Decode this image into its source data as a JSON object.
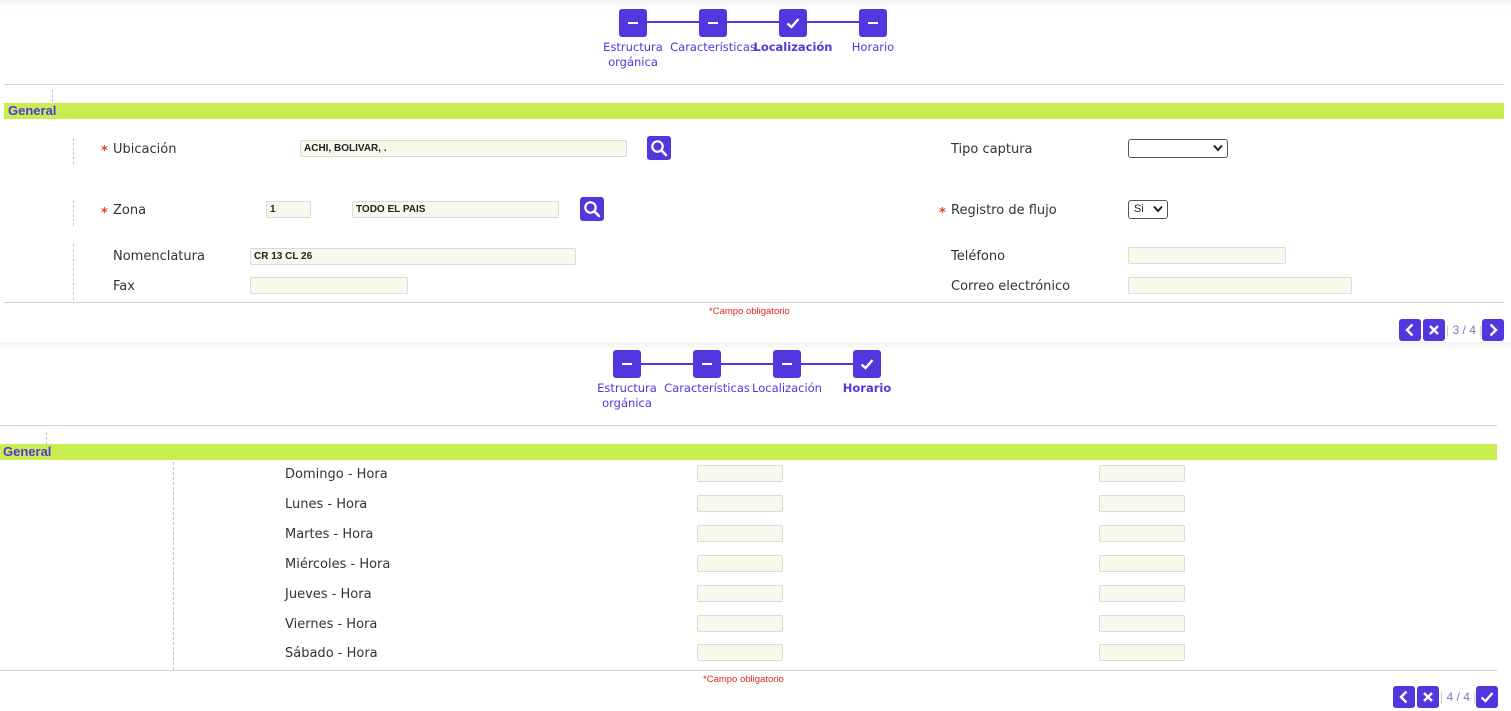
{
  "colors": {
    "accent": "#5236de",
    "section_bar": "#c9ec51",
    "required": "#e0452a",
    "input_bg": "#f7f9ec"
  },
  "panel1": {
    "steps": [
      {
        "label": "Estructura orgánica",
        "icon": "minus-icon"
      },
      {
        "label": "Características",
        "icon": "minus-icon"
      },
      {
        "label": "Localización",
        "icon": "check-icon",
        "active": true
      },
      {
        "label": "Horario",
        "icon": "minus-icon"
      }
    ],
    "section_title": "General",
    "fields": {
      "ubicacion_label": "Ubicación",
      "ubicacion_value": "ACHI, BOLIVAR, .",
      "tipo_captura_label": "Tipo captura",
      "tipo_captura_value": "",
      "zona_label": "Zona",
      "zona_code": "1",
      "zona_name": "TODO EL PAIS",
      "registro_flujo_label": "Registro de flujo",
      "registro_flujo_value": "Si",
      "nomenclatura_label": "Nomenclatura",
      "nomenclatura_value": "CR 13 CL 26",
      "telefono_label": "Teléfono",
      "telefono_value": "",
      "fax_label": "Fax",
      "fax_value": "",
      "correo_label": "Correo electrónico",
      "correo_value": ""
    },
    "required_marker": "*",
    "required_note": "Campo obligatorio",
    "pager": {
      "current": "3",
      "total": "4",
      "sep": "|",
      "slash": "/"
    }
  },
  "panel2": {
    "steps": [
      {
        "label": "Estructura orgánica",
        "icon": "minus-icon"
      },
      {
        "label": "Características",
        "icon": "minus-icon"
      },
      {
        "label": "Localización",
        "icon": "minus-icon"
      },
      {
        "label": "Horario",
        "icon": "check-icon",
        "active": true
      }
    ],
    "section_title": "General",
    "schedule": [
      {
        "label": "Domingo - Hora",
        "from": "",
        "to": ""
      },
      {
        "label": "Lunes - Hora",
        "from": "",
        "to": ""
      },
      {
        "label": "Martes - Hora",
        "from": "",
        "to": ""
      },
      {
        "label": "Miércoles - Hora",
        "from": "",
        "to": ""
      },
      {
        "label": "Jueves - Hora",
        "from": "",
        "to": ""
      },
      {
        "label": "Viernes - Hora",
        "from": "",
        "to": ""
      },
      {
        "label": "Sábado - Hora",
        "from": "",
        "to": ""
      }
    ],
    "required_marker": "*",
    "required_note": "Campo obligatorio",
    "pager": {
      "current": "4",
      "total": "4",
      "sep": "|",
      "slash": "/"
    }
  }
}
